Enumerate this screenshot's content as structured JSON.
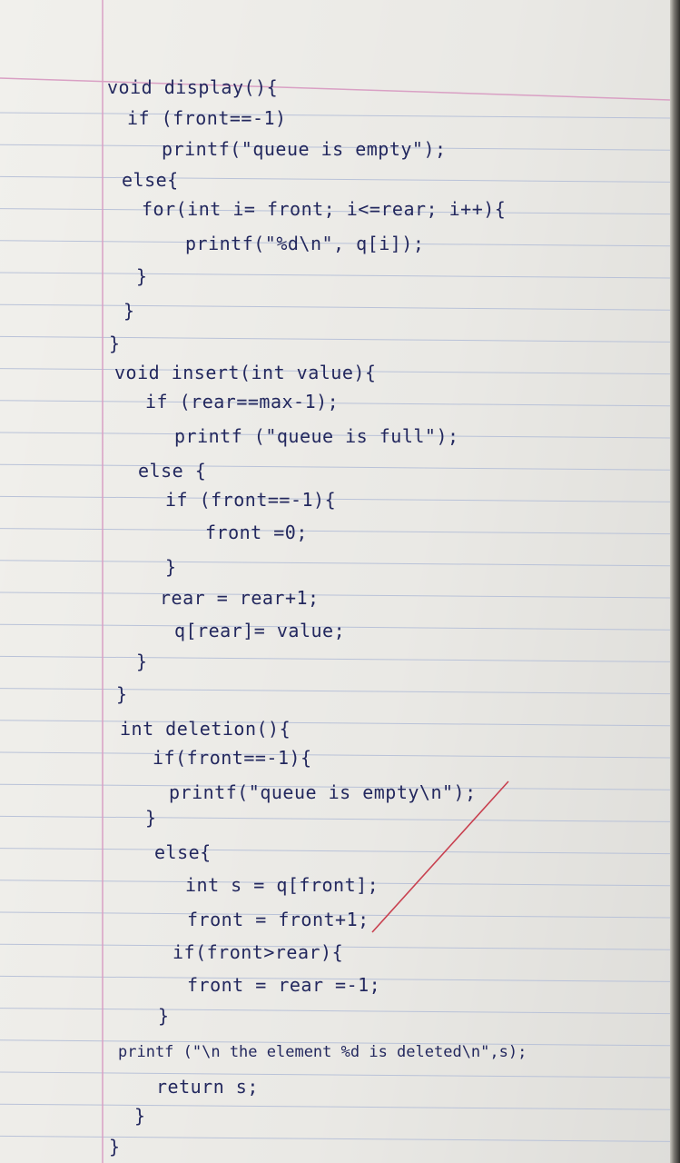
{
  "notebook": {
    "lines": [
      "void display(){",
      "if (front==-1)",
      "printf(\"queue is empty\");",
      "else{",
      "for(int i= front; i<=rear; i++){",
      "printf(\"%d\\n\", q[i]);",
      "}",
      "}",
      "}",
      "void insert(int value){",
      "if (rear==max-1);",
      "printf (\"queue is full\");",
      "else {",
      "if (front==-1){",
      "front =0;",
      "}",
      "rear = rear+1;",
      "q[rear]= value;",
      "}",
      "}",
      "int deletion(){",
      "if(front==-1){",
      "printf(\"queue is empty\\n\");",
      "}",
      "else{",
      "int s = q[front];",
      "front = front+1;",
      "if(front>rear){",
      "front = rear =-1;",
      "}",
      "printf (\"\\n the element %d is deleted\\n\",s);",
      "return s;",
      "}",
      "}"
    ],
    "ink_color": "#23285e",
    "margin_color": "#d9a0c4",
    "rule_color": "#b9c2d8",
    "strike_color": "#c8404f"
  }
}
